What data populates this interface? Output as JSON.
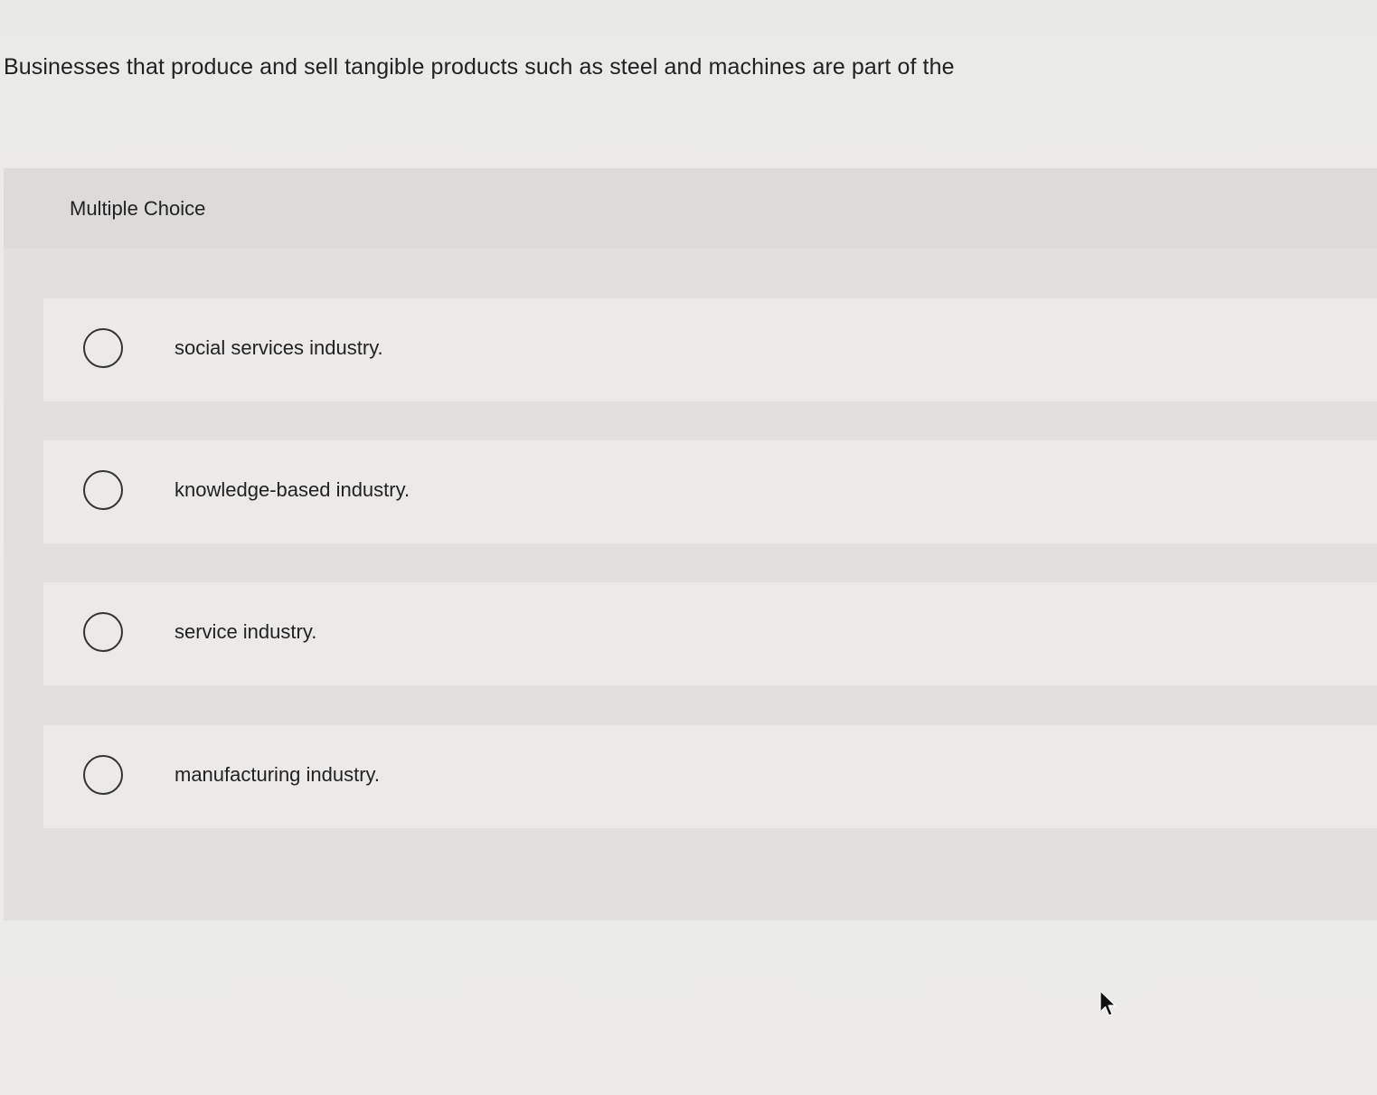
{
  "question": {
    "text": "Businesses that produce and sell tangible products such as steel and machines are part of the"
  },
  "multiple_choice": {
    "header": "Multiple Choice",
    "options": [
      {
        "label": "social services industry.",
        "selected": false
      },
      {
        "label": "knowledge-based industry.",
        "selected": false
      },
      {
        "label": "service industry.",
        "selected": false
      },
      {
        "label": "manufacturing industry.",
        "selected": false
      }
    ]
  },
  "icons": {
    "radio": "radio-unselected-icon",
    "cursor": "mouse-pointer-icon"
  }
}
